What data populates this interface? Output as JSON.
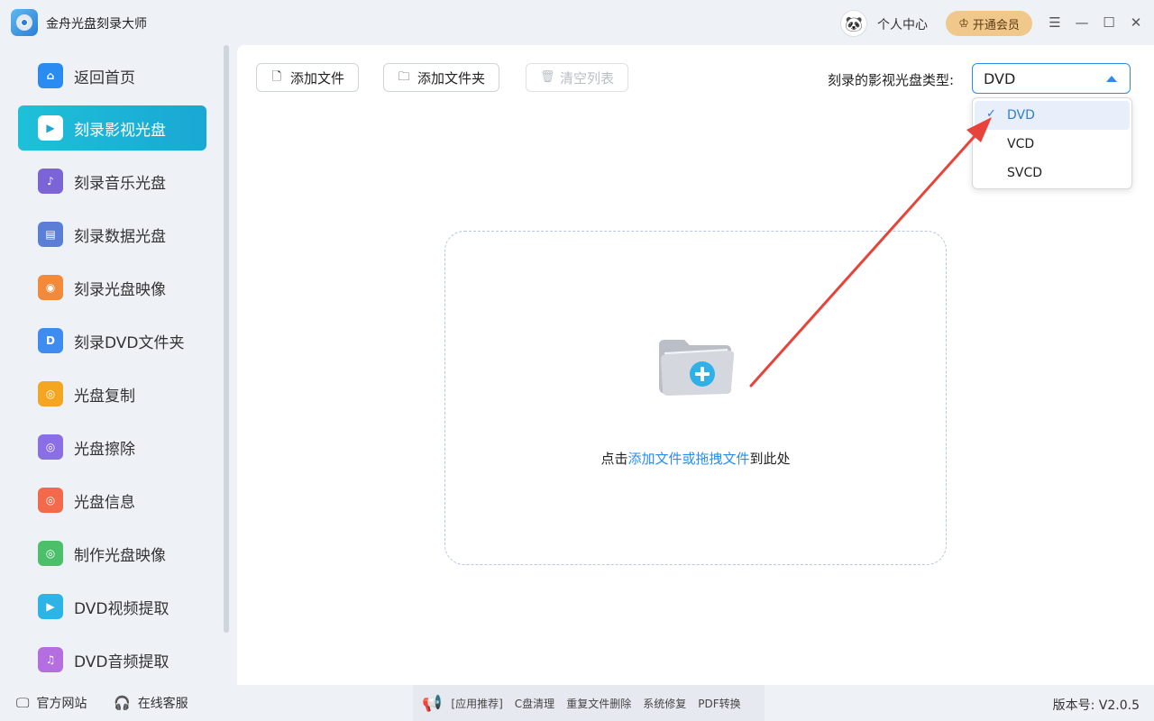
{
  "app": {
    "title": "金舟光盘刻录大师",
    "user_center": "个人中心",
    "vip_label": "开通会员"
  },
  "sidebar": {
    "items": [
      {
        "label": "返回首页",
        "icon": "home-icon",
        "color": "#2a8cf0"
      },
      {
        "label": "刻录影视光盘",
        "icon": "video-disc-icon",
        "color": "#ffffff"
      },
      {
        "label": "刻录音乐光盘",
        "icon": "music-disc-icon",
        "color": "#7b63d8"
      },
      {
        "label": "刻录数据光盘",
        "icon": "data-disc-icon",
        "color": "#5b7fd6"
      },
      {
        "label": "刻录光盘映像",
        "icon": "disc-image-icon",
        "color": "#f28a3a"
      },
      {
        "label": "刻录DVD文件夹",
        "icon": "dvd-folder-icon",
        "color": "#3f8cf0"
      },
      {
        "label": "光盘复制",
        "icon": "disc-copy-icon",
        "color": "#f4a623"
      },
      {
        "label": "光盘擦除",
        "icon": "disc-erase-icon",
        "color": "#8a6ee6"
      },
      {
        "label": "光盘信息",
        "icon": "disc-info-icon",
        "color": "#f26a4a"
      },
      {
        "label": "制作光盘映像",
        "icon": "make-image-icon",
        "color": "#4cbf6b"
      },
      {
        "label": "DVD视频提取",
        "icon": "video-extract-icon",
        "color": "#2db3e6"
      },
      {
        "label": "DVD音频提取",
        "icon": "audio-extract-icon",
        "color": "#b46ee0"
      }
    ],
    "active_index": 1
  },
  "toolbar": {
    "add_file": "添加文件",
    "add_folder": "添加文件夹",
    "clear_list": "清空列表",
    "type_label": "刻录的影视光盘类型:",
    "selected_type": "DVD",
    "options": [
      "DVD",
      "VCD",
      "SVCD"
    ]
  },
  "dropzone": {
    "prefix": "点击",
    "link": "添加文件或拖拽文件",
    "suffix": "到此处"
  },
  "footer": {
    "website": "官方网站",
    "support": "在线客服",
    "promo_tag": "[应用推荐]",
    "promo_links": [
      "C盘清理",
      "重复文件删除",
      "系统修复",
      "PDF转换"
    ],
    "version": "版本号: V2.0.5"
  },
  "colors": {
    "accent": "#2a8cf0",
    "active_sidebar": "#1ec0d8",
    "annotation_arrow": "#e8433a"
  }
}
